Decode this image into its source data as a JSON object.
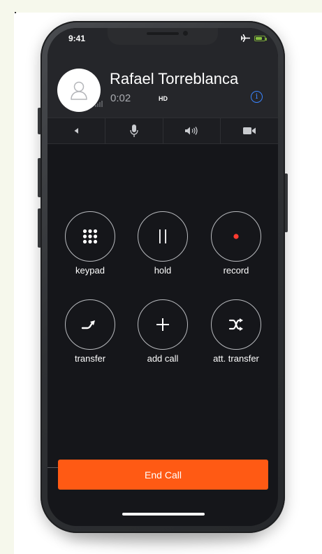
{
  "status_bar": {
    "time": "9:41",
    "airplane_icon": "airplane-icon",
    "battery_icon": "battery-icon",
    "battery_level": 0.75
  },
  "call": {
    "caller_name": "Rafael Torreblanca",
    "duration": "0:02",
    "quality_badge": "HD",
    "info_icon_glyph": "i"
  },
  "toolbar": {
    "items": [
      {
        "name": "speaker-left",
        "icon": "volume-low-icon"
      },
      {
        "name": "mute",
        "icon": "microphone-icon"
      },
      {
        "name": "speaker",
        "icon": "speaker-icon"
      },
      {
        "name": "video",
        "icon": "video-camera-icon"
      }
    ]
  },
  "actions": [
    {
      "label": "keypad",
      "icon": "keypad-icon"
    },
    {
      "label": "hold",
      "icon": "pause-icon"
    },
    {
      "label": "record",
      "icon": "record-icon"
    },
    {
      "label": "transfer",
      "icon": "transfer-arrow-icon"
    },
    {
      "label": "add call",
      "icon": "plus-icon"
    },
    {
      "label": "att. transfer",
      "icon": "shuffle-icon"
    }
  ],
  "end_call": {
    "label": "End Call"
  },
  "colors": {
    "screen_bg": "#15161a",
    "header_bg": "#25262a",
    "accent_end_call": "#ff5a14",
    "record_dot": "#ff3b30",
    "info_blue": "#3a85ff",
    "battery_green": "#8ac43f"
  }
}
